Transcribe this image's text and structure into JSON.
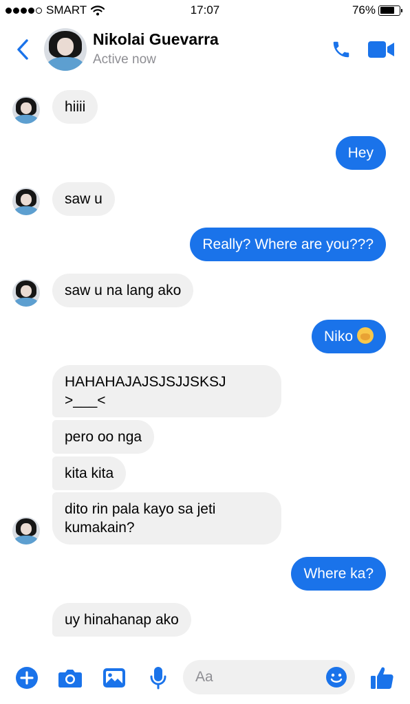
{
  "status_bar": {
    "carrier": "SMART",
    "time": "17:07",
    "battery": "76%",
    "battery_level": 0.76
  },
  "header": {
    "contact_name": "Nikolai Guevarra",
    "contact_status": "Active now"
  },
  "messages": [
    {
      "direction": "in",
      "text": "hiiii"
    },
    {
      "direction": "out",
      "text": "Hey"
    },
    {
      "direction": "in",
      "text": "saw u"
    },
    {
      "direction": "out",
      "text": "Really? Where are you???"
    },
    {
      "direction": "in",
      "text": "saw u na lang ako"
    },
    {
      "direction": "out",
      "text": "Niko",
      "emoji": "face-with-hand-emoji"
    },
    {
      "direction": "in",
      "lines": [
        "HAHAHAJAJSJSJJSKSJ",
        ">___<"
      ]
    },
    {
      "direction": "in",
      "text": "pero oo nga"
    },
    {
      "direction": "in",
      "text": "kita kita"
    },
    {
      "direction": "in",
      "lines": [
        "dito rin pala kayo sa jeti",
        "kumakain?"
      ]
    },
    {
      "direction": "out",
      "text": "Where ka?"
    },
    {
      "direction": "in",
      "text": "uy hinahanap ako"
    }
  ],
  "composer": {
    "placeholder": "Aa"
  },
  "colors": {
    "accent": "#1a73ea",
    "incoming_bubble": "#f0f0f0",
    "secondary_text": "#8e8e93"
  },
  "icons": [
    "back-chevron-icon",
    "phone-icon",
    "video-camera-icon",
    "plus-icon",
    "camera-icon",
    "image-icon",
    "microphone-icon",
    "emoji-icon",
    "thumbs-up-icon",
    "wifi-icon",
    "battery-icon",
    "signal-dots-icon"
  ]
}
